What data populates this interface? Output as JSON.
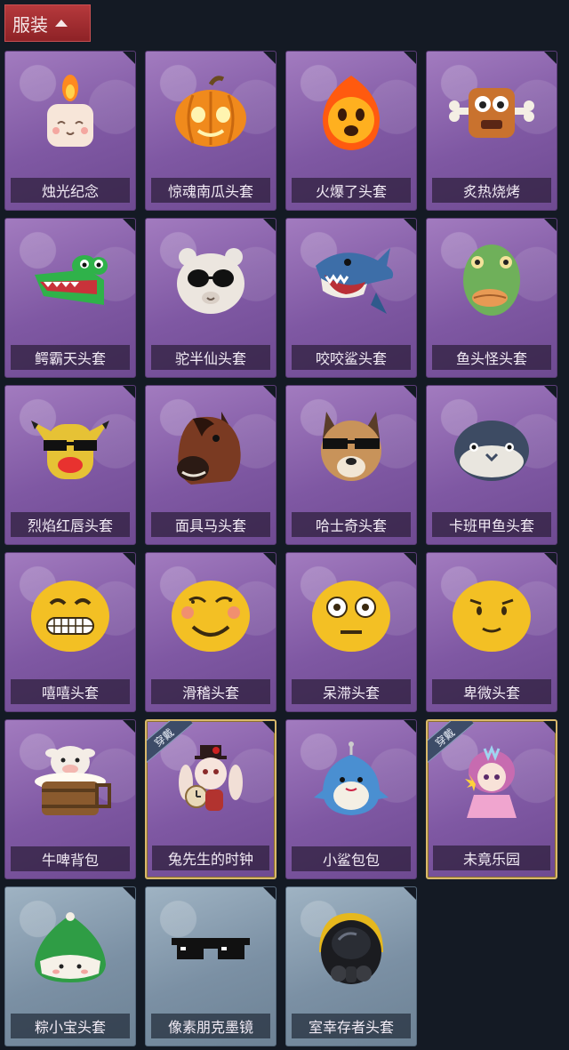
{
  "section": {
    "title": "服装",
    "expanded": true
  },
  "items": [
    {
      "name": "烛光纪念",
      "icon": "candle-icon",
      "theme": "purple",
      "worn": false
    },
    {
      "name": "惊魂南瓜头套",
      "icon": "pumpkin-icon",
      "theme": "purple",
      "worn": false
    },
    {
      "name": "火爆了头套",
      "icon": "fireball-icon",
      "theme": "purple",
      "worn": false
    },
    {
      "name": "炙热烧烤",
      "icon": "grilled-meat-icon",
      "theme": "purple",
      "worn": false
    },
    {
      "name": "鳄霸天头套",
      "icon": "crocodile-icon",
      "theme": "purple",
      "worn": false
    },
    {
      "name": "驼半仙头套",
      "icon": "alpaca-sunglasses-icon",
      "theme": "purple",
      "worn": false
    },
    {
      "name": "咬咬鲨头套",
      "icon": "shark-icon",
      "theme": "purple",
      "worn": false
    },
    {
      "name": "鱼头怪头套",
      "icon": "fish-head-icon",
      "theme": "purple",
      "worn": false
    },
    {
      "name": "烈焰红唇头套",
      "icon": "yellow-pika-icon",
      "theme": "purple",
      "worn": false
    },
    {
      "name": "面具马头套",
      "icon": "horse-mask-icon",
      "theme": "purple",
      "worn": false
    },
    {
      "name": "哈士奇头套",
      "icon": "husky-icon",
      "theme": "purple",
      "worn": false
    },
    {
      "name": "卡班甲鱼头套",
      "icon": "round-fish-icon",
      "theme": "purple",
      "worn": false
    },
    {
      "name": "嘻嘻头套",
      "icon": "grin-emoji-icon",
      "theme": "purple",
      "worn": false
    },
    {
      "name": "滑稽头套",
      "icon": "funny-emoji-icon",
      "theme": "purple",
      "worn": false
    },
    {
      "name": "呆滞头套",
      "icon": "dazed-emoji-icon",
      "theme": "purple",
      "worn": false
    },
    {
      "name": "卑微头套",
      "icon": "humble-emoji-icon",
      "theme": "purple",
      "worn": false
    },
    {
      "name": "牛啤背包",
      "icon": "cow-barrel-icon",
      "theme": "purple",
      "worn": false
    },
    {
      "name": "兔先生的时钟",
      "icon": "rabbit-clock-icon",
      "theme": "purple",
      "worn": true
    },
    {
      "name": "小鲨包包",
      "icon": "shark-bag-icon",
      "theme": "purple",
      "worn": false
    },
    {
      "name": "未竟乐园",
      "icon": "doll-girl-icon",
      "theme": "purple",
      "worn": true
    },
    {
      "name": "粽小宝头套",
      "icon": "zongzi-icon",
      "theme": "blue",
      "worn": false
    },
    {
      "name": "像素朋克墨镜",
      "icon": "pixel-sunglasses-icon",
      "theme": "blue",
      "worn": false
    },
    {
      "name": "室幸存者头套",
      "icon": "gas-mask-helmet-icon",
      "theme": "blue",
      "worn": false
    }
  ],
  "worn_badge_label": "穿戴",
  "colors": {
    "header_bg": "#a52e31",
    "card_purple": "#8a62ad",
    "card_blue": "#7f93a6",
    "worn_border": "#d8b86a",
    "background": "#141a24"
  }
}
